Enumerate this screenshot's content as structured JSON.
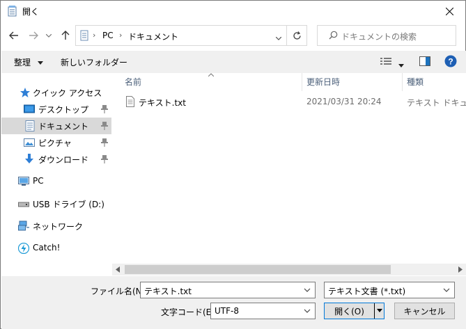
{
  "window": {
    "title": "開く"
  },
  "address": {
    "crumbs": [
      "PC",
      "ドキュメント"
    ]
  },
  "search": {
    "placeholder": "ドキュメントの検索"
  },
  "toolbar": {
    "organize_label": "整理",
    "new_folder_label": "新しいフォルダー"
  },
  "sidebar": {
    "items": [
      {
        "label": "クイック アクセス"
      },
      {
        "label": "デスクトップ"
      },
      {
        "label": "ドキュメント"
      },
      {
        "label": "ピクチャ"
      },
      {
        "label": "ダウンロード"
      },
      {
        "label": "PC"
      },
      {
        "label": "USB ドライブ (D:)"
      },
      {
        "label": "ネットワーク"
      },
      {
        "label": "Catch!"
      }
    ]
  },
  "columns": {
    "name": "名前",
    "modified": "更新日時",
    "type": "種類"
  },
  "files": [
    {
      "name": "テキスト.txt",
      "modified": "2021/03/31 20:24",
      "type": "テキスト ドキュメント"
    }
  ],
  "footer": {
    "filename_label": "ファイル名(N):",
    "filename_value": "テキスト.txt",
    "filetype_value": "テキスト文書 (*.txt)",
    "encoding_label": "文字コード(E):",
    "encoding_value": "UTF-8",
    "open_label": "開く(O)",
    "cancel_label": "キャンセル"
  },
  "colors": {
    "accent": "#0078d7",
    "selection": "#d9d9d9",
    "folder_yellow": "#e8b84a",
    "column_header_text": "#4c607a"
  }
}
